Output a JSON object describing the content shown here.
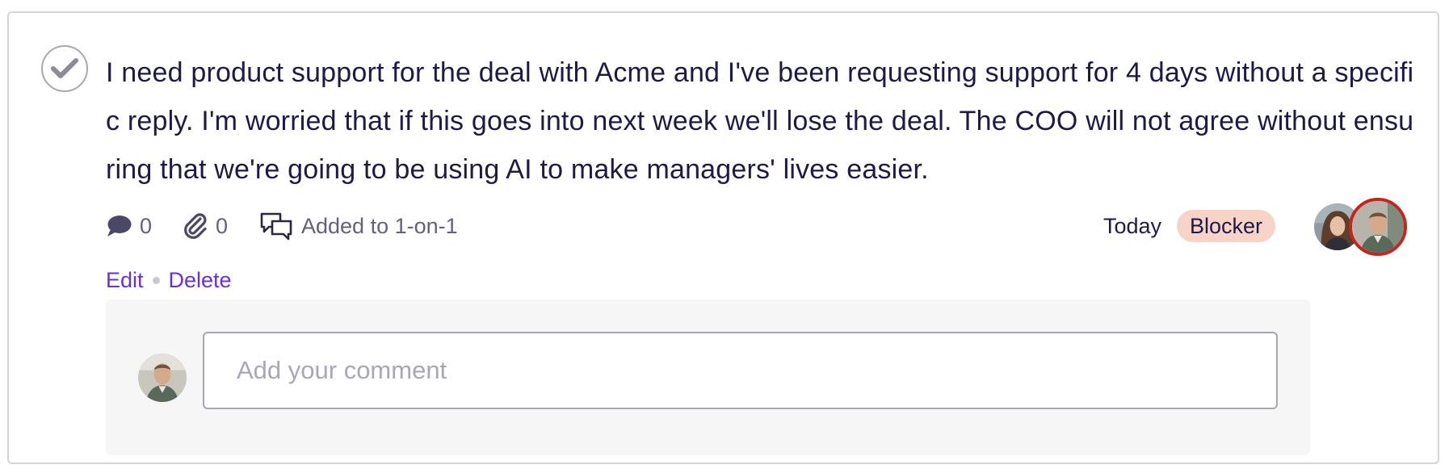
{
  "item": {
    "text": "I need product support for the deal with Acme and I've been requesting support for 4 days without a specific reply. I'm worried that if this goes into next week we'll lose the deal. The COO will not agree without ensuring that we're going to be using AI to make managers' lives easier.",
    "comment_count": "0",
    "attachment_count": "0",
    "one_on_one_label": "Added to 1-on-1",
    "date": "Today",
    "tag": "Blocker",
    "edit_label": "Edit",
    "delete_label": "Delete"
  },
  "comment": {
    "placeholder": "Add your comment"
  },
  "colors": {
    "text": "#1d1a48",
    "link": "#6b2ed8",
    "badge_bg": "#f8d3c8",
    "active_avatar_ring": "#c4261d"
  },
  "icons": [
    "check-icon",
    "comment-icon",
    "paperclip-icon",
    "one-on-one-icon"
  ]
}
